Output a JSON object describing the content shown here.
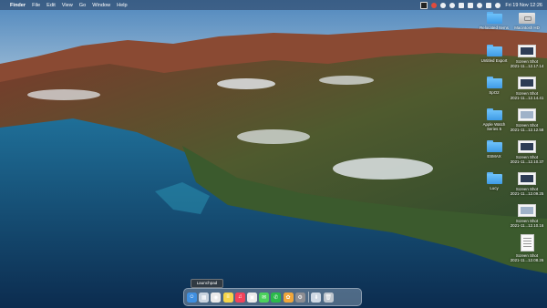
{
  "menubar": {
    "app_name": "Finder",
    "items": [
      "File",
      "Edit",
      "View",
      "Go",
      "Window",
      "Help"
    ],
    "clock": "Fri 19 Nov  12:26",
    "status_icons": [
      "dropbox-icon",
      "record-icon",
      "eye-icon",
      "moon-icon",
      "wifi-icon",
      "battery-icon",
      "search-icon",
      "control-center-icon",
      "siri-icon"
    ]
  },
  "desktop": {
    "left_column": [
      {
        "icon": "folder-icon",
        "label": "Relocated Items"
      },
      {
        "icon": "folder-icon",
        "label": "Untitled Export"
      },
      {
        "icon": "folder-icon",
        "label": "SpO2"
      },
      {
        "icon": "folder-icon",
        "label": "Apple Watch",
        "label2": "Series 5"
      },
      {
        "icon": "folder-icon",
        "label": "ESMAX"
      },
      {
        "icon": "folder-icon",
        "label": "Lucy"
      }
    ],
    "right_column": [
      {
        "icon": "drive-icon",
        "label": "Macintosh HD"
      },
      {
        "icon": "screenshot-icon",
        "label": "Screen Shot",
        "label2": "2021-11...12.17.14"
      },
      {
        "icon": "screenshot-icon",
        "label": "Screen Shot",
        "label2": "2021-11...12.14.41"
      },
      {
        "icon": "screenshot-icon",
        "label": "Screen Shot",
        "label2": "2021-11...12.12.58"
      },
      {
        "icon": "screenshot-icon",
        "label": "Screen Shot",
        "label2": "2021-11...12.10.37"
      },
      {
        "icon": "screenshot-icon",
        "label": "Screen Shot",
        "label2": "2021-11...12.09.25"
      },
      {
        "icon": "screenshot-icon",
        "label": "Screen Shot",
        "label2": "2021-11...12.10.16"
      },
      {
        "icon": "document-icon",
        "label": "Screen Shot",
        "label2": "2021-11...12.08.26"
      }
    ]
  },
  "dock": {
    "tooltip": "Launchpad",
    "apps": [
      {
        "name": "finder-app-icon",
        "color": "#3f8fe0",
        "glyph": "☺"
      },
      {
        "name": "launchpad-app-icon",
        "color": "#c9d3de",
        "glyph": "▦"
      },
      {
        "name": "chrome-app-icon",
        "color": "#e9e9e9",
        "glyph": "◉"
      },
      {
        "name": "notes-app-icon",
        "color": "#f5d54a",
        "glyph": "≡"
      },
      {
        "name": "music-app-icon",
        "color": "#f2435b",
        "glyph": "♫"
      },
      {
        "name": "preview-app-icon",
        "color": "#eaeaea",
        "glyph": "▣"
      },
      {
        "name": "messages-app-icon",
        "color": "#4bd15c",
        "glyph": "✉"
      },
      {
        "name": "whatsapp-app-icon",
        "color": "#2ab94a",
        "glyph": "✆"
      },
      {
        "name": "photos-app-icon",
        "color": "#f0a63a",
        "glyph": "✿"
      },
      {
        "name": "system-preferences-app-icon",
        "color": "#8e8e93",
        "glyph": "⚙"
      },
      {
        "name": "downloads-stack-icon",
        "color": "#cfd8e3",
        "glyph": "⬇"
      },
      {
        "name": "trash-icon",
        "color": "#bfc6ce",
        "glyph": "🗑"
      }
    ]
  }
}
